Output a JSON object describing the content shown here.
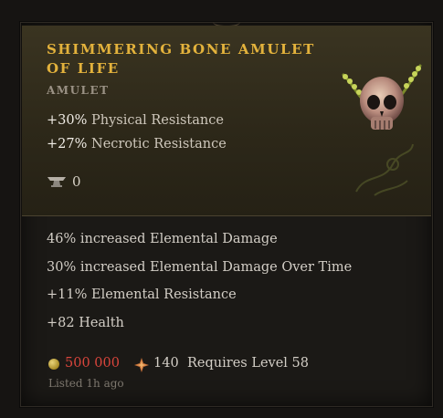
{
  "item": {
    "title": "Shimmering Bone Amulet of Life",
    "type": "AMULET",
    "implicits": [
      {
        "value": "+30%",
        "label": "Physical Resistance"
      },
      {
        "value": "+27%",
        "label": "Necrotic Resistance"
      }
    ],
    "masterwork_count": "0",
    "affixes": [
      "46% increased Elemental Damage",
      "30% increased Elemental Damage Over Time",
      "+11% Elemental Resistance",
      "+82 Health"
    ]
  },
  "listing": {
    "price": "500 000",
    "shard_count": "140",
    "requirement": "Requires Level 58",
    "listed": "Listed 1h ago"
  },
  "colors": {
    "title": "#e3b23c",
    "price": "#d9453c",
    "header_bg": "#2d2819"
  },
  "icons": [
    "amulet-skull-icon",
    "anvil-icon",
    "gold-coin-icon",
    "shard-icon"
  ]
}
